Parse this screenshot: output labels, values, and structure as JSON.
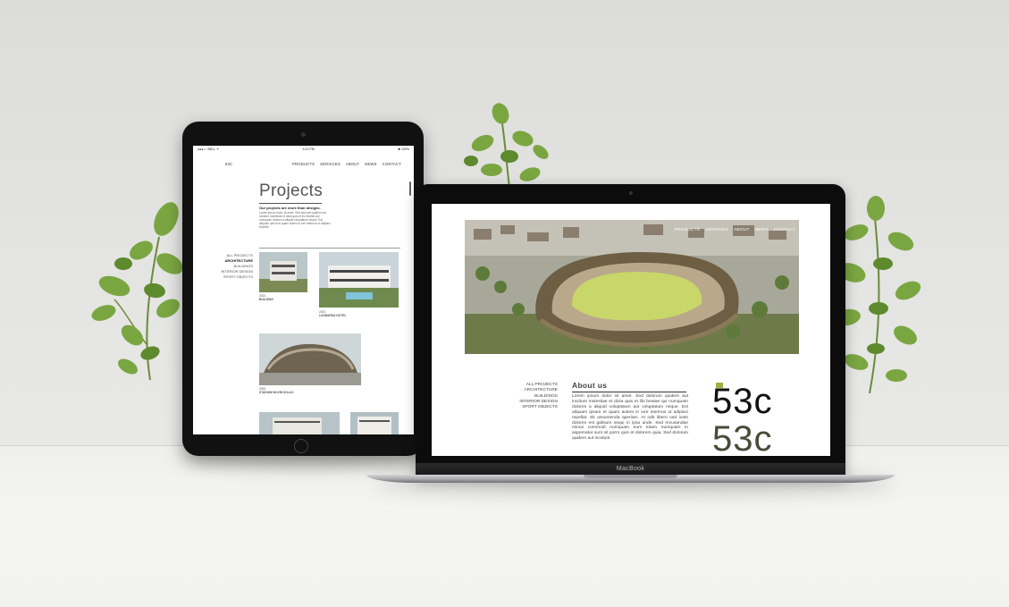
{
  "colors": {
    "wall": "#dcdcda",
    "floor": "#f2f2f0",
    "device": "#111111",
    "accent_olive": "#a4b03a",
    "logo_dark": "#111111",
    "logo_olive": "#4b4a38"
  },
  "tablet": {
    "status": {
      "left": "●●●○○ BELL ᯤ",
      "time": "4:21 PM",
      "right": "✱ 100%"
    },
    "nav": {
      "logo": "53C",
      "links": [
        "PRODUCTS",
        "SERVICES",
        "ABOUT",
        "NEWS",
        "CONTACT"
      ]
    },
    "title": "Projects",
    "subtitle": "Our projects are more than designs.",
    "intro": "Lorem ipsum dolor sit amet, Sed dolorum quidem aut incidunt molestiae et dicta quis et illo beatae qui numquam dolores a aliquid voluptatum neque. Est aliquam ipsum et quam autem in iure internos ut adipisci repellat.",
    "categories": [
      "ALL PROJECTS",
      "ARCHITECTURE",
      "BUILDINGS",
      "INTERIOR DESIGN",
      "SPORT OBJECTS"
    ],
    "active_category": "ARCHITECTURE",
    "projects": [
      {
        "year": "2021",
        "name": "BUILDING"
      },
      {
        "year": "2021",
        "name": "LUXBARDA HOTEL"
      },
      {
        "year": "2020",
        "name": "STADIUM NOVIN DOLAC"
      }
    ]
  },
  "laptop": {
    "nav": {
      "links": [
        "PRODUCTS",
        "SERVICES",
        "ABOUT",
        "NEWS",
        "CONTACT"
      ]
    },
    "categories": [
      "ALL PROJECTS",
      "ARCHITECTURE",
      "BUILDINGS",
      "INTERIOR DESIGN",
      "SPORT OBJECTS"
    ],
    "about_title": "About us",
    "about_text": "Lorem ipsum dolor sit amet. Sed dolorum quidem aut incidunt molestiae et dicta quis et illo beatae qui numquam dolores a aliquid voluptatum aut voluptatum neque. Est aliquam ipsam et quam autem in iure internos ut adipisci repellat. Sit assumenda aperiam. At odit libero sed iusto dolores est galisum sequi in ipsa unde. Sed recusandae minus commodi numquam eum totam numquam in aspernatur sunt sit porro quis et dolorem quia. Sed dolorum quidem aut incidunt",
    "logo_text": "53c",
    "brand": "MacBook"
  }
}
